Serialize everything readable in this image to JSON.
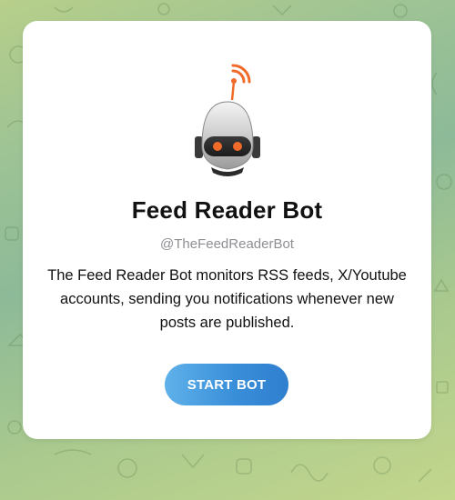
{
  "bot": {
    "name": "Feed Reader Bot",
    "username": "@TheFeedReaderBot",
    "description": "The Feed Reader Bot monitors RSS feeds, X/Youtube accounts, sending you notifications whenever new posts are published.",
    "avatar_icon": "robot-rss-icon"
  },
  "actions": {
    "start_label": "START BOT"
  },
  "colors": {
    "button_start": "#5fb1ea",
    "button_end": "#2f7fcf",
    "accent_orange": "#f06a2a",
    "background": "#9cc295"
  }
}
